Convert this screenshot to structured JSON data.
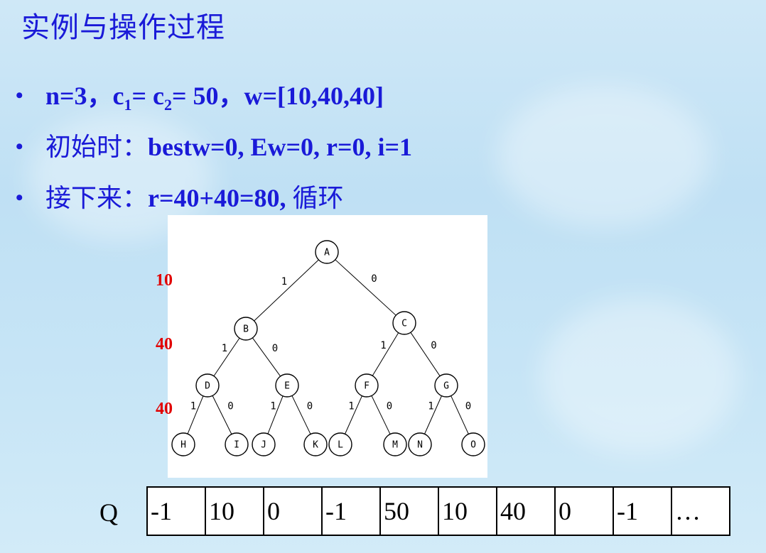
{
  "title": "实例与操作过程",
  "bullets": [
    {
      "b1_n": "n=3，",
      "b1_c1": "c",
      "b1_c1_sub": "1",
      "b1_mid": "= c",
      "b1_c2_sub": "2",
      "b1_rest": "= 50，w=[10,40,40]"
    },
    {
      "label": "初始时：",
      "text": "bestw=0, Ew=0, r=0, i=1"
    },
    {
      "label": "接下来：",
      "text": "r=40+40=80,",
      "tail": "循环"
    }
  ],
  "tree": {
    "nodes": [
      "A",
      "B",
      "C",
      "D",
      "E",
      "F",
      "G",
      "H",
      "I",
      "J",
      "K",
      "L",
      "M",
      "N",
      "O"
    ],
    "edge_labels": {
      "left": "1",
      "right": "0"
    },
    "level_weights": [
      "10",
      "40",
      "40"
    ]
  },
  "queue": {
    "label": "Q",
    "cells": [
      "-1",
      "10",
      "0",
      "-1",
      "50",
      "10",
      "40",
      "0",
      "-1",
      "…"
    ]
  },
  "colors": {
    "title": "#1a1ad8",
    "weights": "#e10000"
  }
}
